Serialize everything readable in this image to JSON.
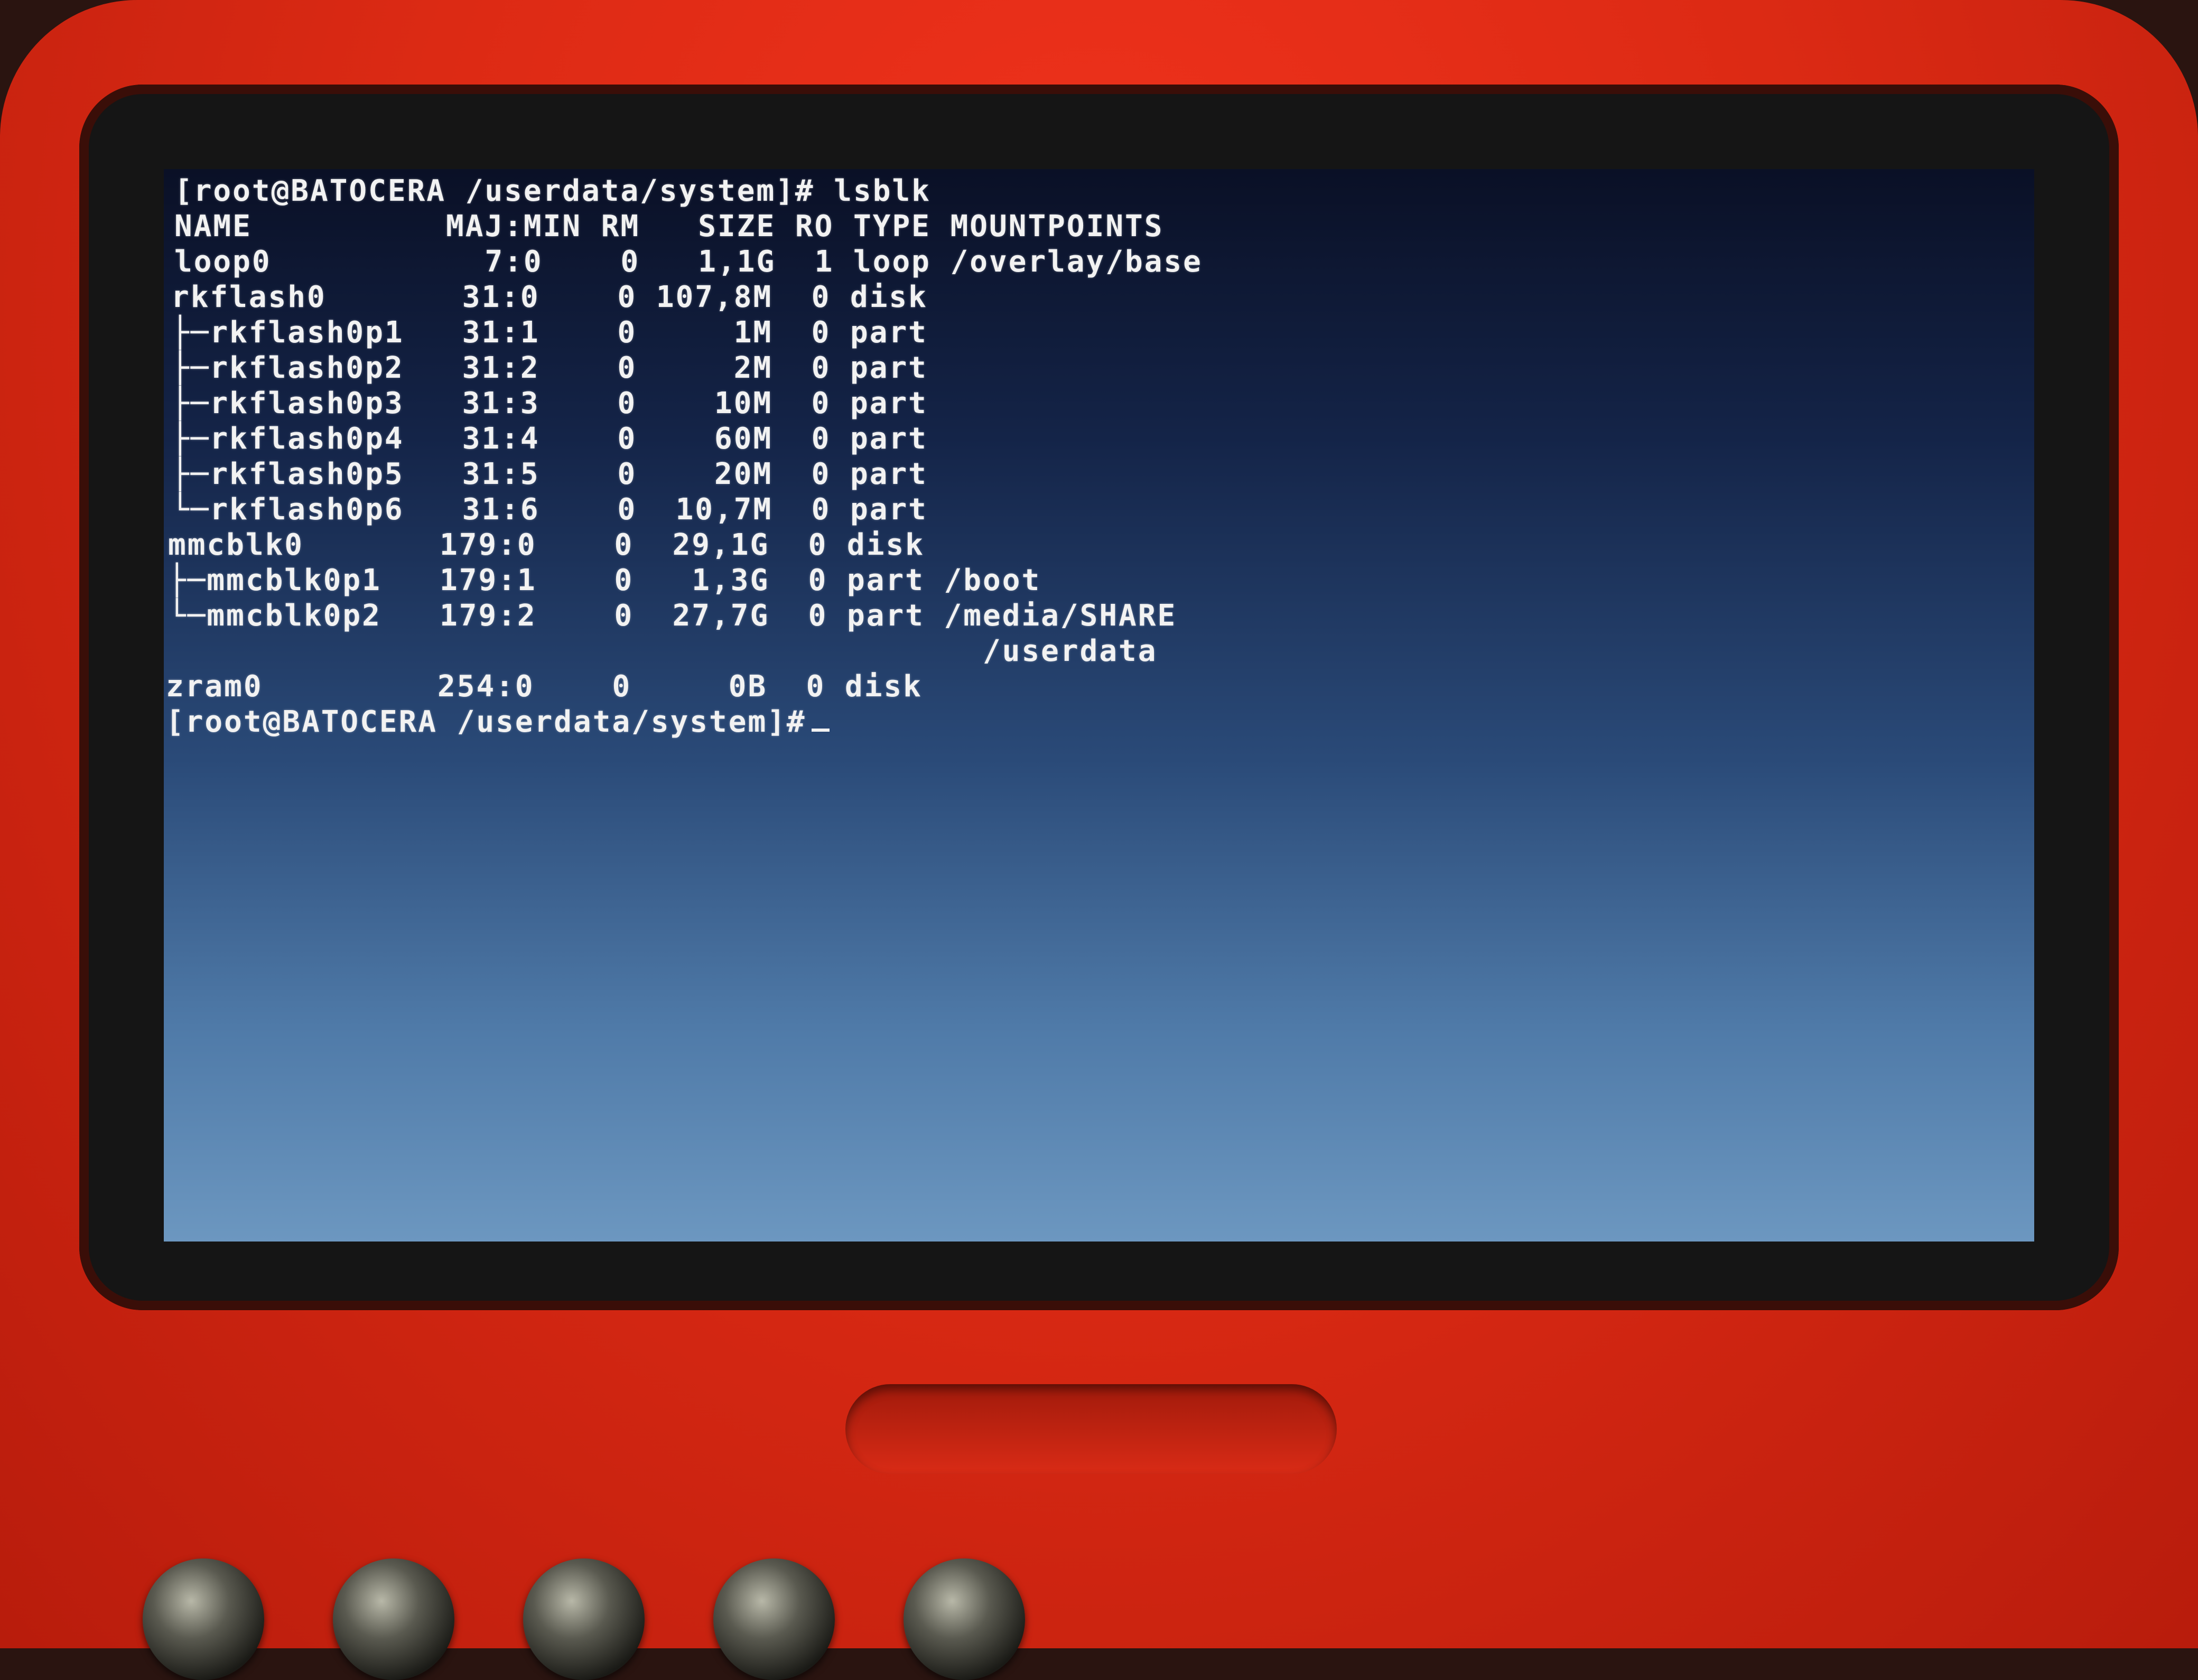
{
  "terminal": {
    "prompt_command": "[root@BATOCERA /userdata/system]# lsblk",
    "header": "NAME          MAJ:MIN RM   SIZE RO TYPE MOUNTPOINTS",
    "rows": [
      "loop0           7:0    0   1,1G  1 loop /overlay/base",
      "rkflash0       31:0    0 107,8M  0 disk",
      "├─rkflash0p1   31:1    0     1M  0 part",
      "├─rkflash0p2   31:2    0     2M  0 part",
      "├─rkflash0p3   31:3    0    10M  0 part",
      "├─rkflash0p4   31:4    0    60M  0 part",
      "├─rkflash0p5   31:5    0    20M  0 part",
      "└─rkflash0p6   31:6    0  10,7M  0 part",
      "mmcblk0       179:0    0  29,1G  0 disk",
      "├─mmcblk0p1   179:1    0   1,3G  0 part /boot",
      "└─mmcblk0p2   179:2    0  27,7G  0 part /media/SHARE",
      "                                          /userdata",
      "zram0         254:0    0     0B  0 disk"
    ],
    "final_prompt": "[root@BATOCERA /userdata/system]#"
  },
  "colors": {
    "device_shell": "#dc2a14",
    "terminal_text": "#f2f2f2",
    "screen_top": "#0a1026",
    "screen_bottom": "#6c97c0"
  }
}
